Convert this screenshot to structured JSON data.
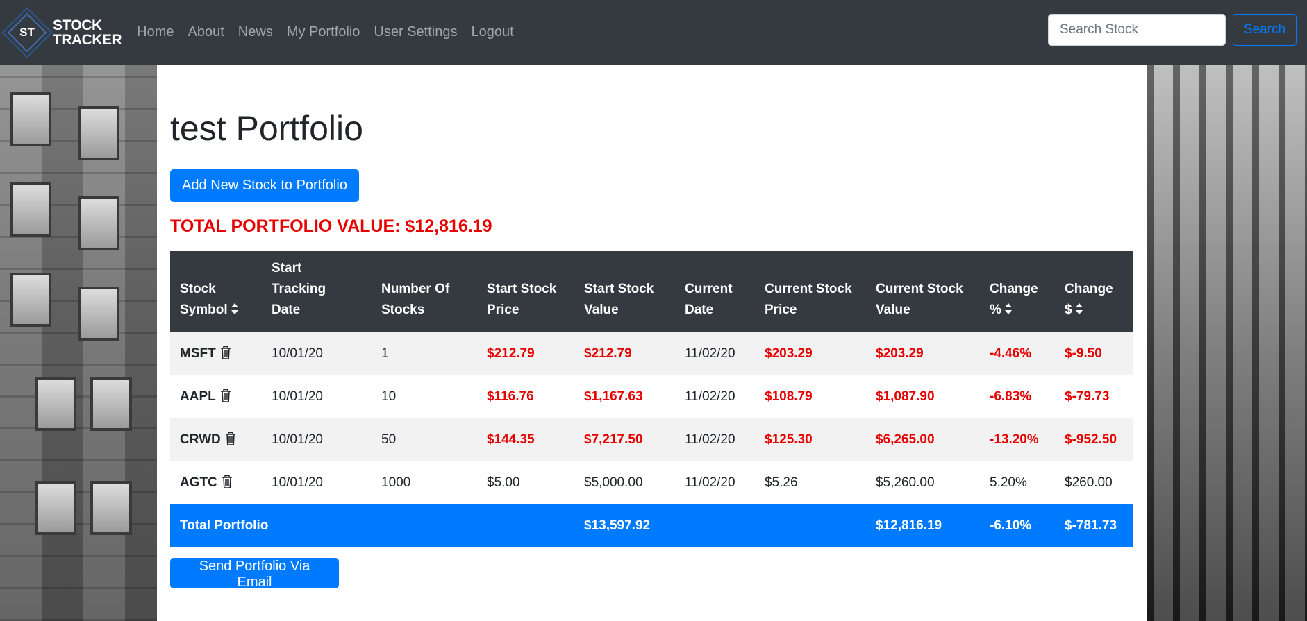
{
  "navbar": {
    "brand_mark": "ST",
    "brand_line1": "STOCK",
    "brand_line2": "TRACKER",
    "links": [
      "Home",
      "About",
      "News",
      "My Portfolio",
      "User Settings",
      "Logout"
    ],
    "search_placeholder": "Search Stock",
    "search_button": "Search"
  },
  "main": {
    "title": "test Portfolio",
    "add_button": "Add New Stock to Portfolio",
    "total_value": "TOTAL PORTFOLIO VALUE: $12,816.19",
    "email_button": "Send Portfolio Via Email"
  },
  "table": {
    "headers": {
      "symbol_1": "Stock",
      "symbol_2": "Symbol",
      "start_date_1": "Start",
      "start_date_2": "Tracking",
      "start_date_3": "Date",
      "num_1": "Number Of",
      "num_2": "Stocks",
      "start_price_1": "Start Stock",
      "start_price_2": "Price",
      "start_value_1": "Start Stock",
      "start_value_2": "Value",
      "current_date_1": "Current",
      "current_date_2": "Date",
      "current_price_1": "Current Stock",
      "current_price_2": "Price",
      "current_value_1": "Current Stock",
      "current_value_2": "Value",
      "change_pct_1": "Change",
      "change_pct_2": "%",
      "change_usd_1": "Change",
      "change_usd_2": "$"
    },
    "rows": [
      {
        "symbol": "MSFT",
        "start_date": "10/01/20",
        "count": "1",
        "start_price": "$212.79",
        "start_value": "$212.79",
        "current_date": "11/02/20",
        "current_price": "$203.29",
        "current_value": "$203.29",
        "change_pct": "-4.46%",
        "change_usd": "$-9.50"
      },
      {
        "symbol": "AAPL",
        "start_date": "10/01/20",
        "count": "10",
        "start_price": "$116.76",
        "start_value": "$1,167.63",
        "current_date": "11/02/20",
        "current_price": "$108.79",
        "current_value": "$1,087.90",
        "change_pct": "-6.83%",
        "change_usd": "$-79.73"
      },
      {
        "symbol": "CRWD",
        "start_date": "10/01/20",
        "count": "50",
        "start_price": "$144.35",
        "start_value": "$7,217.50",
        "current_date": "11/02/20",
        "current_price": "$125.30",
        "current_value": "$6,265.00",
        "change_pct": "-13.20%",
        "change_usd": "$-952.50"
      },
      {
        "symbol": "AGTC",
        "start_date": "10/01/20",
        "count": "1000",
        "start_price": "$5.00",
        "start_value": "$5,000.00",
        "current_date": "11/02/20",
        "current_price": "$5.26",
        "current_value": "$5,260.00",
        "change_pct": "5.20%",
        "change_usd": "$260.00"
      }
    ],
    "total": {
      "label": "Total Portfolio",
      "start_value": "$13,597.92",
      "current_value": "$12,816.19",
      "change_pct": "-6.10%",
      "change_usd": "$-781.73"
    }
  },
  "colors": {
    "navbar_bg": "#343a40",
    "primary": "#007bff",
    "negative": "#e60000"
  },
  "icons": {
    "sort": "sort-icon",
    "delete": "trash-icon",
    "logo": "stock-tracker-logo-icon"
  }
}
